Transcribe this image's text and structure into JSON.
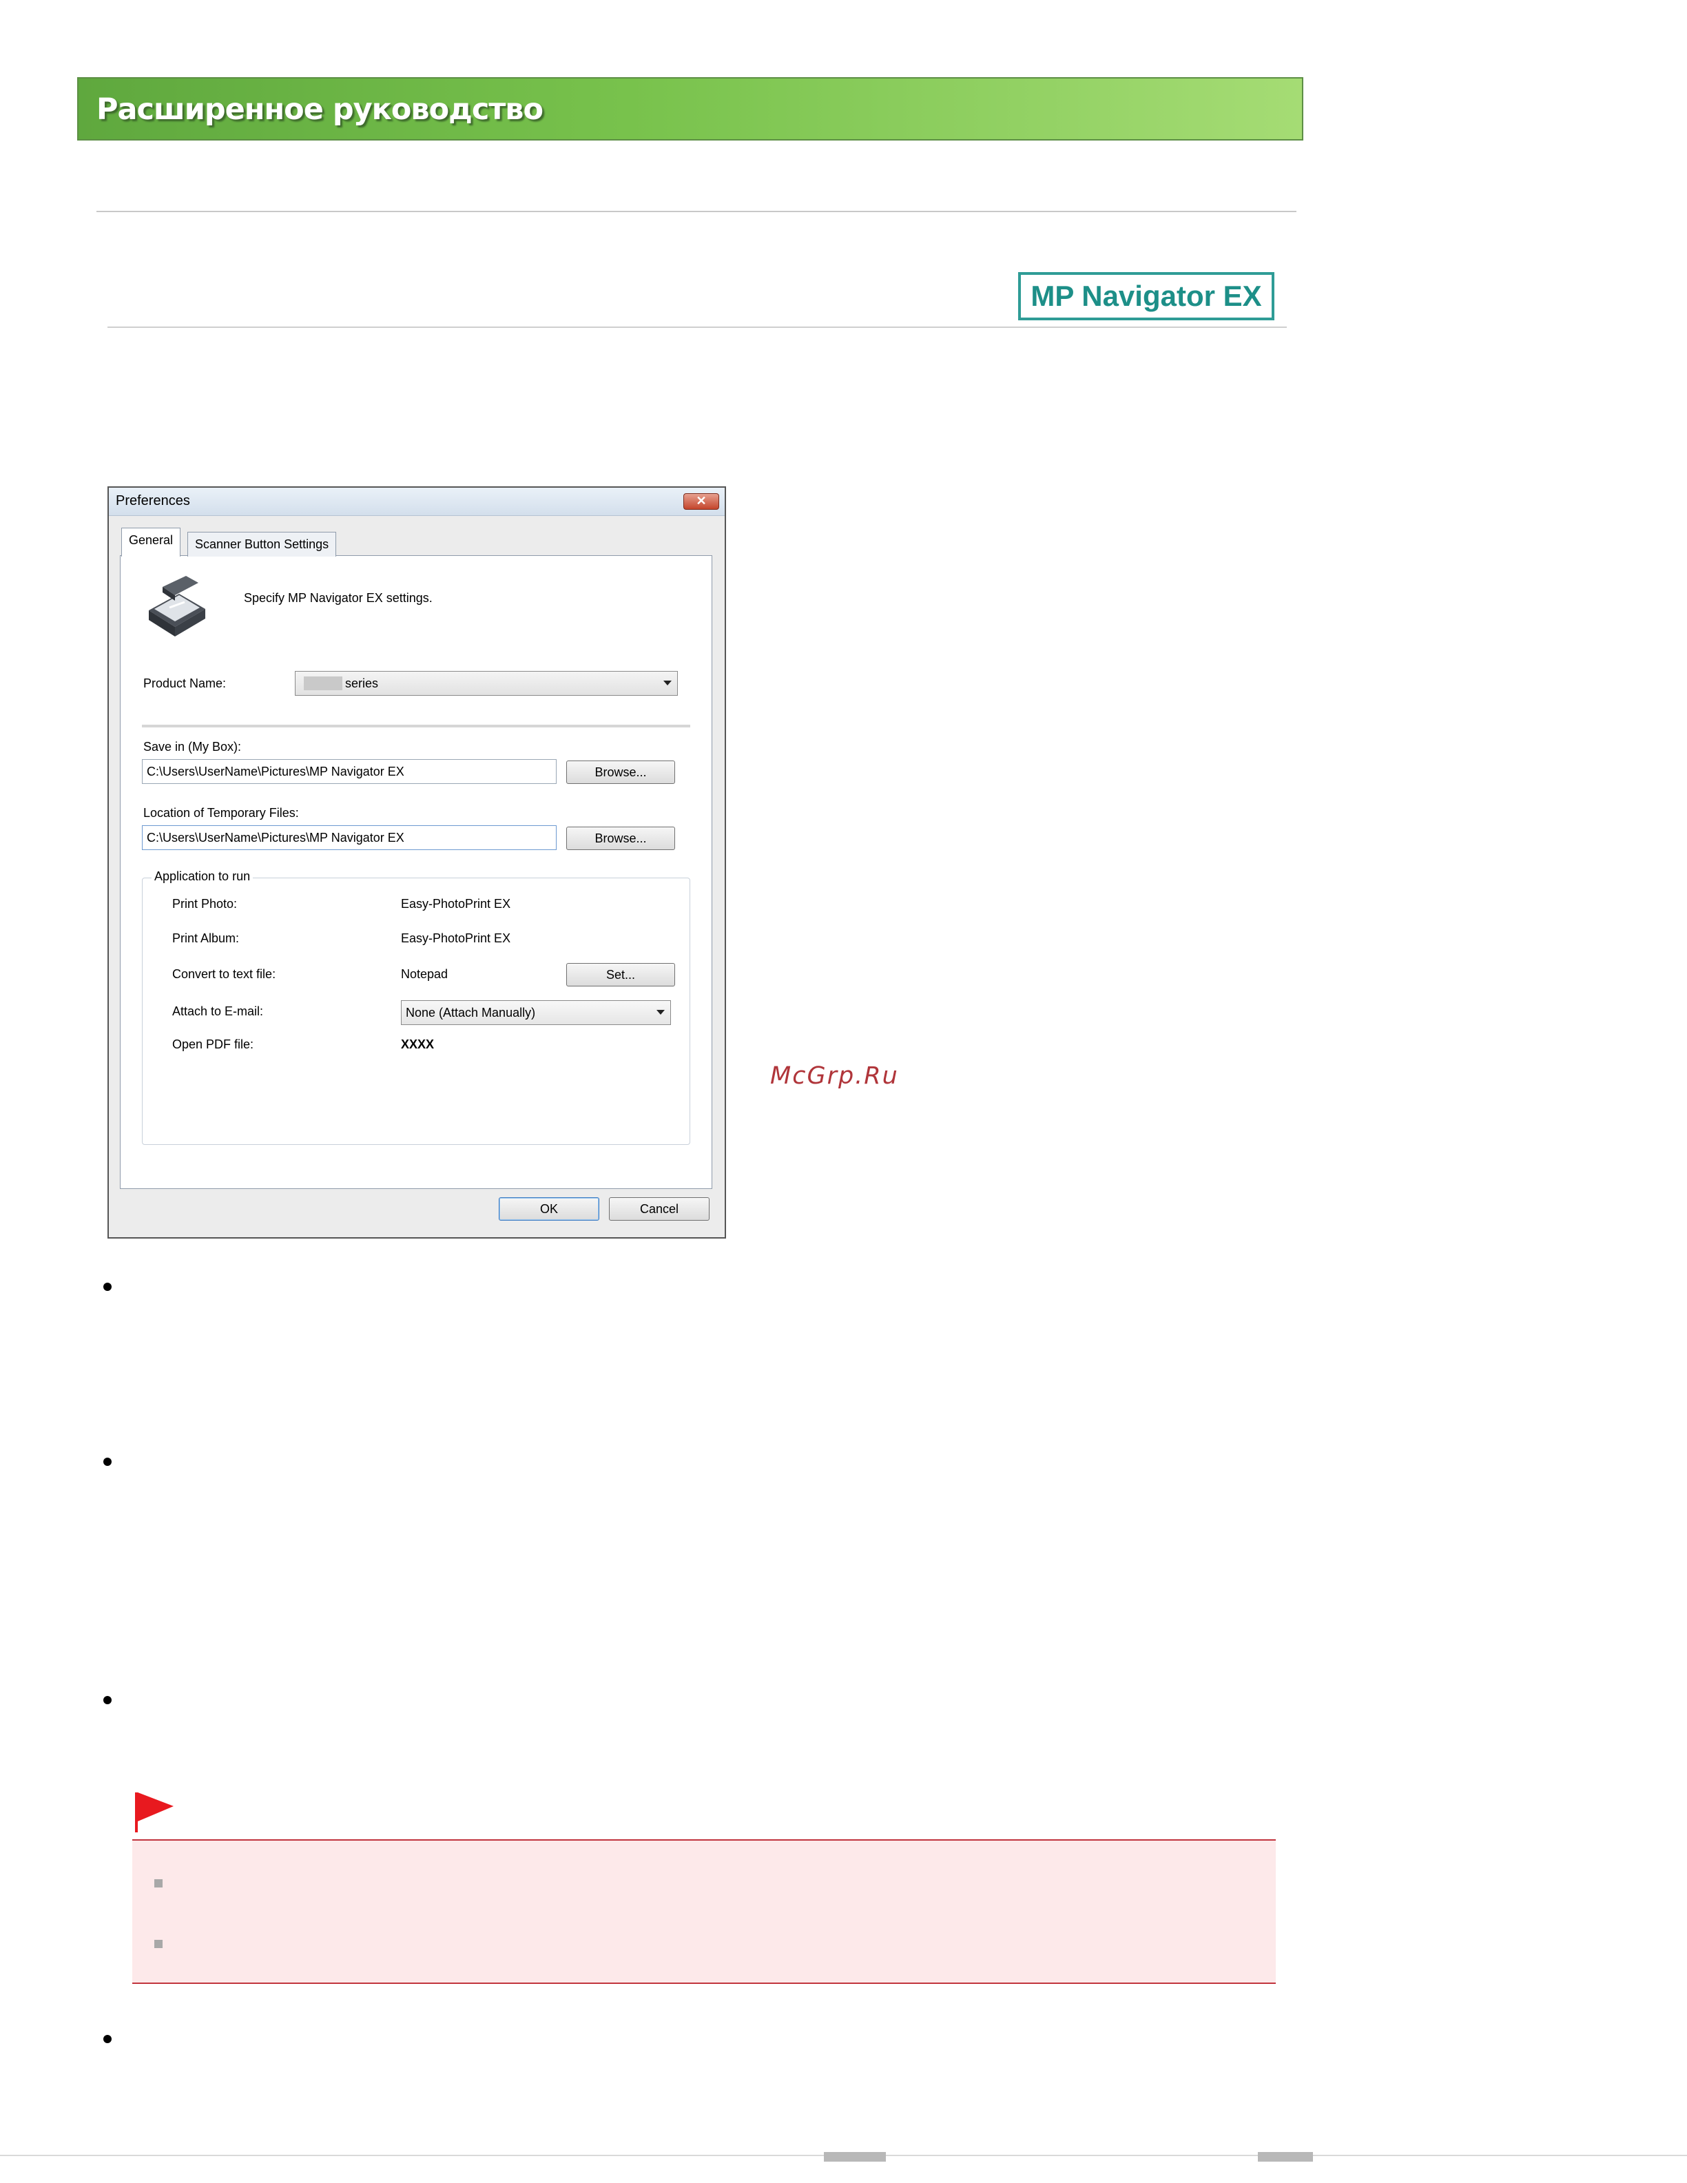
{
  "header": {
    "title": "Расширенное руководство",
    "logo_text": "MP Navigator EX"
  },
  "dialog": {
    "title": "Preferences",
    "close_symbol": "✕",
    "tabs": [
      "General",
      "Scanner Button Settings"
    ],
    "intro": "Specify MP Navigator EX settings.",
    "product_name_label": "Product Name:",
    "product_name_value": "series",
    "save_in_label": "Save in (My Box):",
    "save_in_value": "C:\\Users\\UserName\\Pictures\\MP Navigator EX",
    "temp_files_label": "Location of Temporary Files:",
    "temp_files_value": "C:\\Users\\UserName\\Pictures\\MP Navigator EX",
    "browse_label": "Browse...",
    "group_label": "Application to run",
    "apps": [
      {
        "label": "Print Photo:",
        "value": "Easy-PhotoPrint EX"
      },
      {
        "label": "Print Album:",
        "value": "Easy-PhotoPrint EX"
      },
      {
        "label": "Convert to text file:",
        "value": "Notepad"
      },
      {
        "label": "Attach to E-mail:",
        "value": "None (Attach Manually)"
      },
      {
        "label": "Open PDF file:",
        "value": "XXXX"
      }
    ],
    "set_label": "Set...",
    "ok_label": "OK",
    "cancel_label": "Cancel"
  },
  "watermark": "McGrp.Ru",
  "colors": {
    "banner_green": "#78c24c",
    "logo_teal": "#2f9c96",
    "important_bg": "#fde9ea",
    "important_border": "#c1343d",
    "flag_red": "#e8191f"
  },
  "icons": {
    "scanner": "scanner-icon",
    "flag": "flag-icon"
  }
}
